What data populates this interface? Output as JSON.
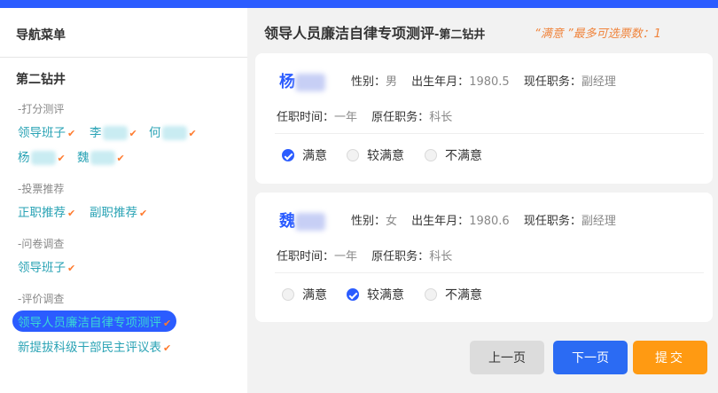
{
  "sidebar": {
    "title": "导航菜单",
    "org": "第二钻井",
    "sections": [
      {
        "label": "-打分测评",
        "items": [
          "领导班子",
          "李",
          "何",
          "杨",
          "魏"
        ]
      },
      {
        "label": "-投票推荐",
        "items": [
          "正职推荐",
          "副职推荐"
        ]
      },
      {
        "label": "-问卷调查",
        "items": [
          "领导班子"
        ]
      },
      {
        "label": "-评价调查",
        "items": [
          "领导人员廉洁自律专项测评",
          "新提拔科级干部民主评议表"
        ]
      }
    ],
    "check_icon": "check-icon",
    "active_item": "领导人员廉洁自律专项测评"
  },
  "header": {
    "title": "领导人员廉洁自律专项测评",
    "subtitle": "-第二钻井",
    "hint": "“满意 ”最多可选票数：1"
  },
  "candidates": [
    {
      "name": "杨",
      "gender_label": "性别：",
      "gender": "男",
      "birth_label": "出生年月：",
      "birth": "1980.5",
      "position_label": "现任职务：",
      "position": "副经理",
      "tenure_label": "任职时间：",
      "tenure": "一年",
      "prev_label": "原任职务：",
      "prev": "科长",
      "options": [
        "满意",
        "较满意",
        "不满意"
      ],
      "selected": "满意"
    },
    {
      "name": "魏",
      "gender_label": "性别：",
      "gender": "女",
      "birth_label": "出生年月：",
      "birth": "1980.6",
      "position_label": "现任职务：",
      "position": "副经理",
      "tenure_label": "任职时间：",
      "tenure": "一年",
      "prev_label": "原任职务：",
      "prev": "科长",
      "options": [
        "满意",
        "较满意",
        "不满意"
      ],
      "selected": "较满意"
    }
  ],
  "buttons": {
    "prev": "上一页",
    "next": "下一页",
    "submit": "提交"
  },
  "colors": {
    "accent": "#2b5cff",
    "link": "#2aa3b5",
    "check": "#ff7a2e",
    "submit": "#ff9a12"
  }
}
